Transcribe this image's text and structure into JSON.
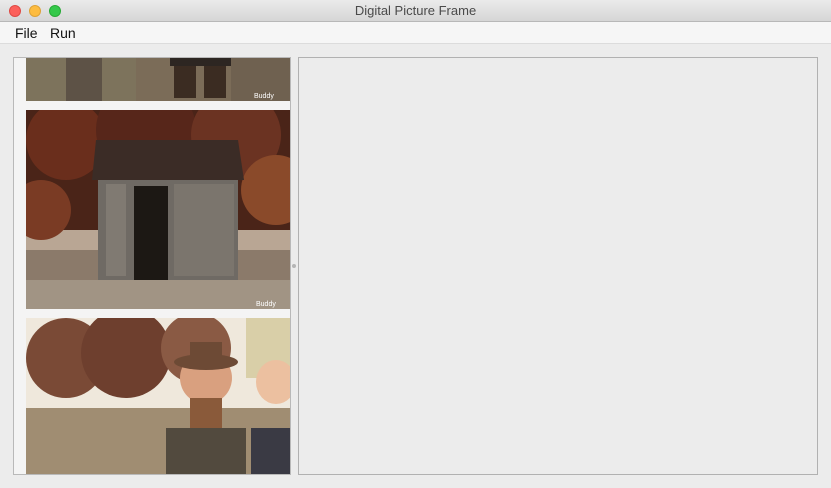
{
  "window": {
    "title": "Digital Picture Frame"
  },
  "menu": {
    "file_label": "File",
    "run_label": "Run"
  },
  "thumbnails": [
    {
      "subject": "boots-photo",
      "watermark": "Buddy"
    },
    {
      "subject": "stone-shed-photo",
      "watermark": "Buddy"
    },
    {
      "subject": "couple-portrait-photo"
    }
  ]
}
